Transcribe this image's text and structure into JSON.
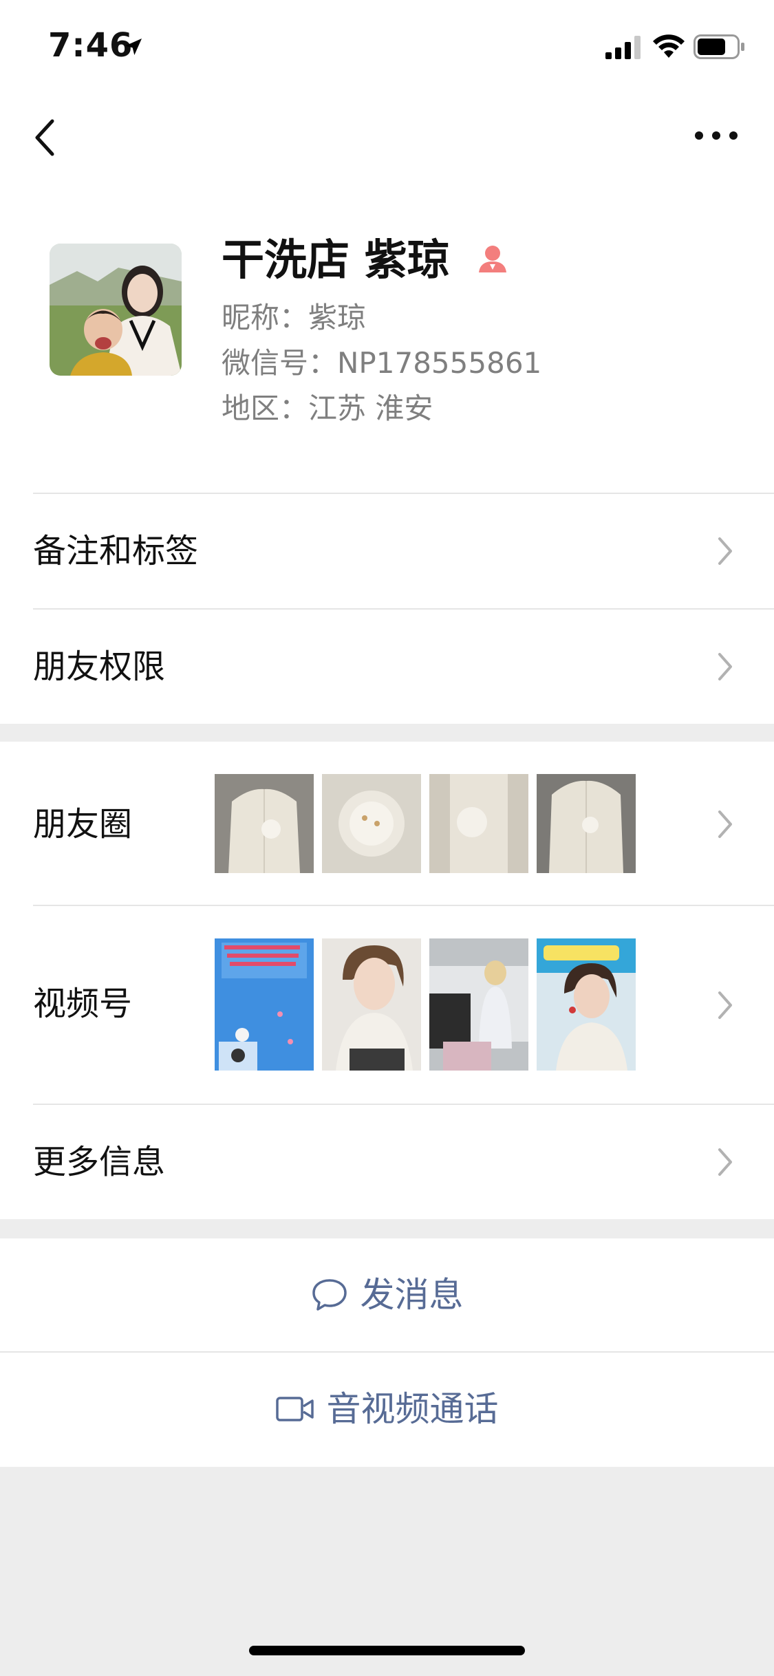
{
  "status_bar": {
    "time": "7:46"
  },
  "profile": {
    "display_name": "干洗店 紫琼",
    "nickname_label": "昵称：",
    "nickname": "紫琼",
    "wechat_id_label": "微信号：",
    "wechat_id": "NP178555861",
    "region_label": "地区：",
    "region": "江苏 淮安"
  },
  "menu": {
    "remarks_tags": "备注和标签",
    "friend_permissions": "朋友权限",
    "moments": "朋友圈",
    "channels": "视频号",
    "more_info": "更多信息"
  },
  "actions": {
    "send_message": "发消息",
    "av_call": "音视频通话"
  },
  "colors": {
    "accent_link": "#576b95",
    "background": "#ededed",
    "female_icon": "#f37e7d"
  },
  "icons": [
    "location-arrow-icon",
    "signal-icon",
    "wifi-icon",
    "battery-icon",
    "back-chevron-icon",
    "more-dots-icon",
    "female-gender-icon",
    "chevron-right-icon",
    "chat-bubble-icon",
    "video-camera-icon"
  ]
}
